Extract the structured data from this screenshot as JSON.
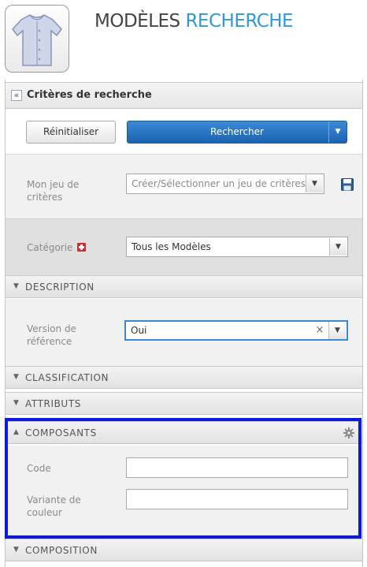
{
  "header": {
    "title_part1": "MODÈLES",
    "title_part2": "RECHERCHE"
  },
  "criteria": {
    "title": "Critères de recherche",
    "collapse_glyph": "«"
  },
  "actions": {
    "reset_label": "Réinitialiser",
    "search_label": "Rechercher"
  },
  "criteria_set": {
    "label": "Mon jeu de critères",
    "placeholder": "Créer/Sélectionner un jeu de critères"
  },
  "category": {
    "label": "Catégorie",
    "value": "Tous les Modèles"
  },
  "sections": {
    "description": "DESCRIPTION",
    "classification": "CLASSIFICATION",
    "attributs": "ATTRIBUTS",
    "composants": "COMPOSANTS",
    "composition": "COMPOSITION"
  },
  "description": {
    "reference_version_label": "Version de référence",
    "reference_version_value": "Oui"
  },
  "composants": {
    "code_label": "Code",
    "code_value": "",
    "color_variant_label": "Variante de couleur",
    "color_variant_value": ""
  },
  "icons": [
    "garment-logo-icon",
    "chevron-down-icon",
    "floppy-save-icon",
    "required-plus-icon",
    "clear-x-icon",
    "gear-icon",
    "chevron-up-icon"
  ],
  "colors": {
    "accent_blue": "#2f9ad8",
    "primary_button": "#1b63b2",
    "highlight_frame": "#0a1ae0",
    "required_red": "#d9262a"
  }
}
